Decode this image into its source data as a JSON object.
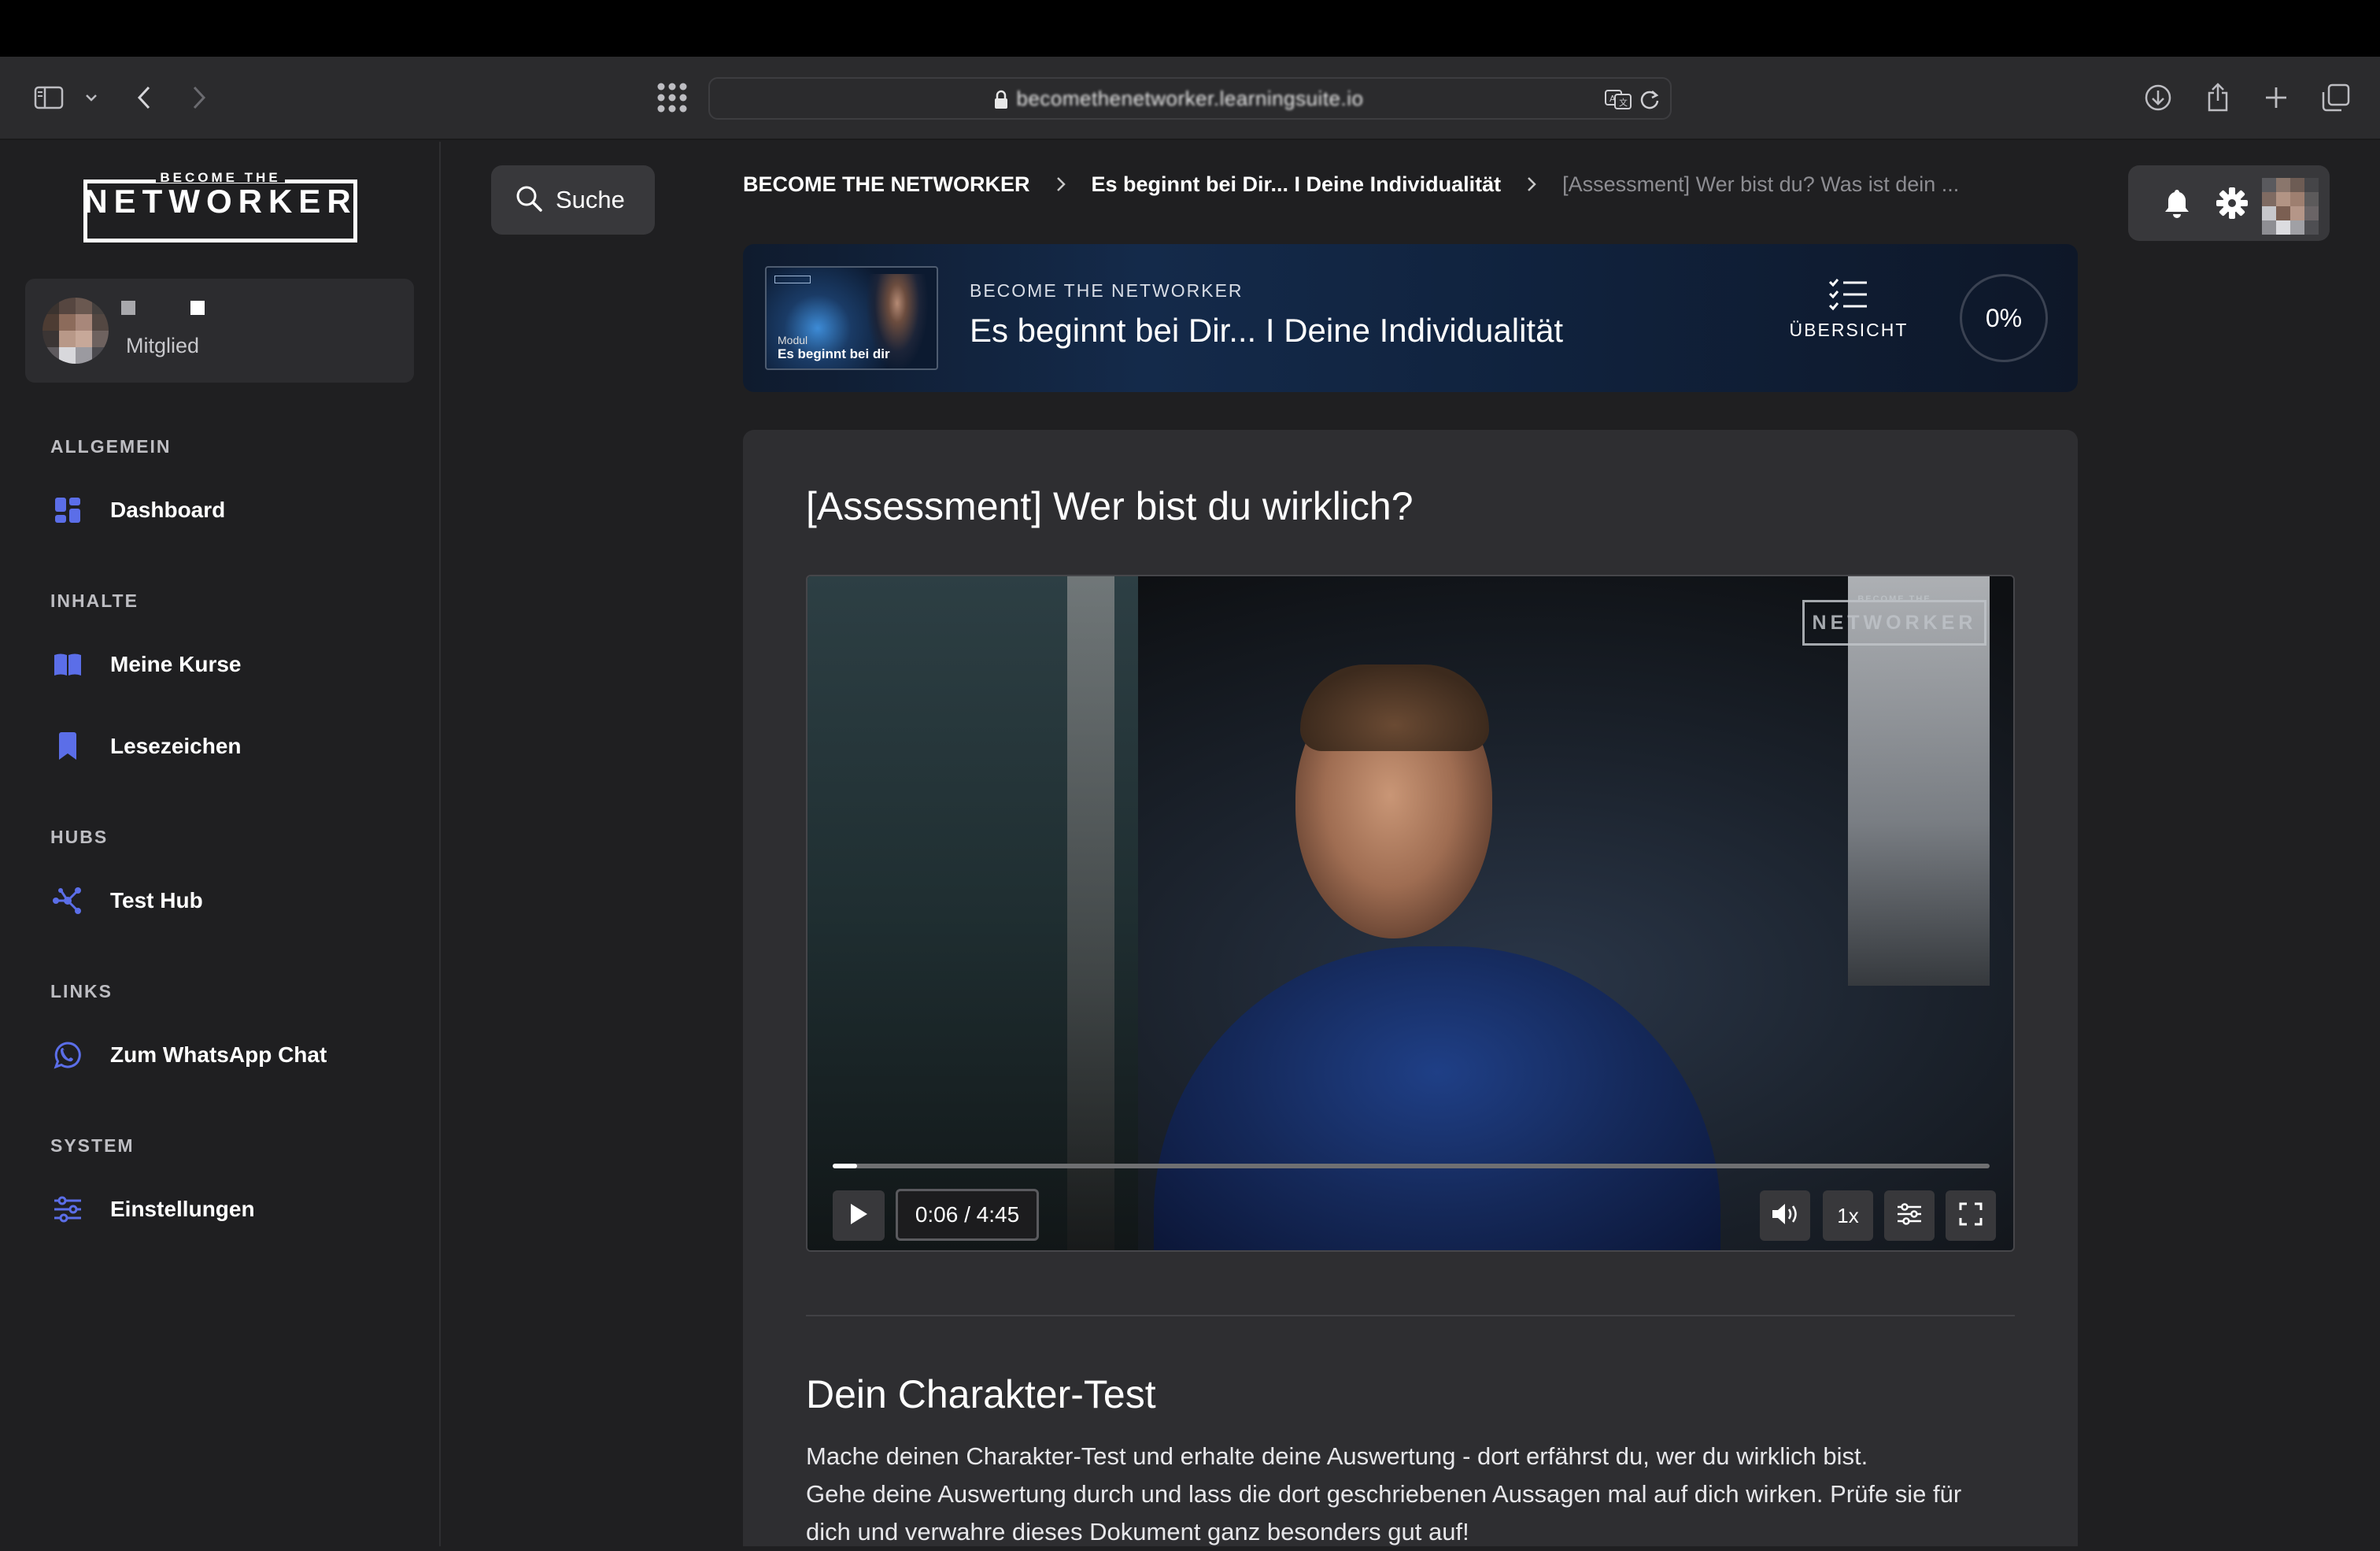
{
  "browser": {
    "url": "becomethenetworker.learningsuite.io",
    "colors": {
      "toolbar": "#2b2b2d",
      "os_bar": "#000000"
    }
  },
  "sidebar": {
    "logo_top": "BECOME THE",
    "logo_main": "NETWORKER",
    "user": {
      "role": "Mitglied"
    },
    "sections": [
      {
        "title": "ALLGEMEIN",
        "items": [
          {
            "label": "Dashboard",
            "icon": "dashboard-icon"
          }
        ]
      },
      {
        "title": "INHALTE",
        "items": [
          {
            "label": "Meine Kurse",
            "icon": "book-icon"
          },
          {
            "label": "Lesezeichen",
            "icon": "bookmark-icon"
          }
        ]
      },
      {
        "title": "HUBS",
        "items": [
          {
            "label": "Test Hub",
            "icon": "hub-icon"
          }
        ]
      },
      {
        "title": "LINKS",
        "items": [
          {
            "label": "Zum WhatsApp Chat",
            "icon": "whatsapp-icon"
          }
        ]
      },
      {
        "title": "SYSTEM",
        "items": [
          {
            "label": "Einstellungen",
            "icon": "sliders-icon"
          }
        ]
      }
    ],
    "accent": "#5b6ee8"
  },
  "search": {
    "label": "Suche"
  },
  "breadcrumb": [
    "BECOME THE NETWORKER",
    "Es beginnt bei Dir... I Deine Individualität",
    "[Assessment] Wer bist du? Was ist dein ..."
  ],
  "course": {
    "kicker": "BECOME THE NETWORKER",
    "title": "Es beginnt bei Dir... I Deine Individualität",
    "thumb_small": "Modul",
    "thumb_title": "Es beginnt bei dir",
    "overview_label": "ÜBERSICHT",
    "progress": "0%"
  },
  "lesson": {
    "title": "[Assessment] Wer bist du wirklich?",
    "video": {
      "logo_top": "BECOME THE",
      "logo_main": "NETWORKER",
      "time": "0:06 / 4:45",
      "played_fraction": 0.021,
      "speed": "1x"
    },
    "section_title": "Dein Charakter-Test",
    "paragraph_lines": [
      "Mache deinen Charakter-Test und erhalte deine Auswertung - dort erfährst du, wer du wirklich bist.",
      "Gehe deine Auswertung durch und lass die dort geschriebenen Aussagen mal auf dich wirken. Prüfe sie für",
      "dich und verwahre dieses Dokument ganz besonders gut auf!"
    ]
  }
}
